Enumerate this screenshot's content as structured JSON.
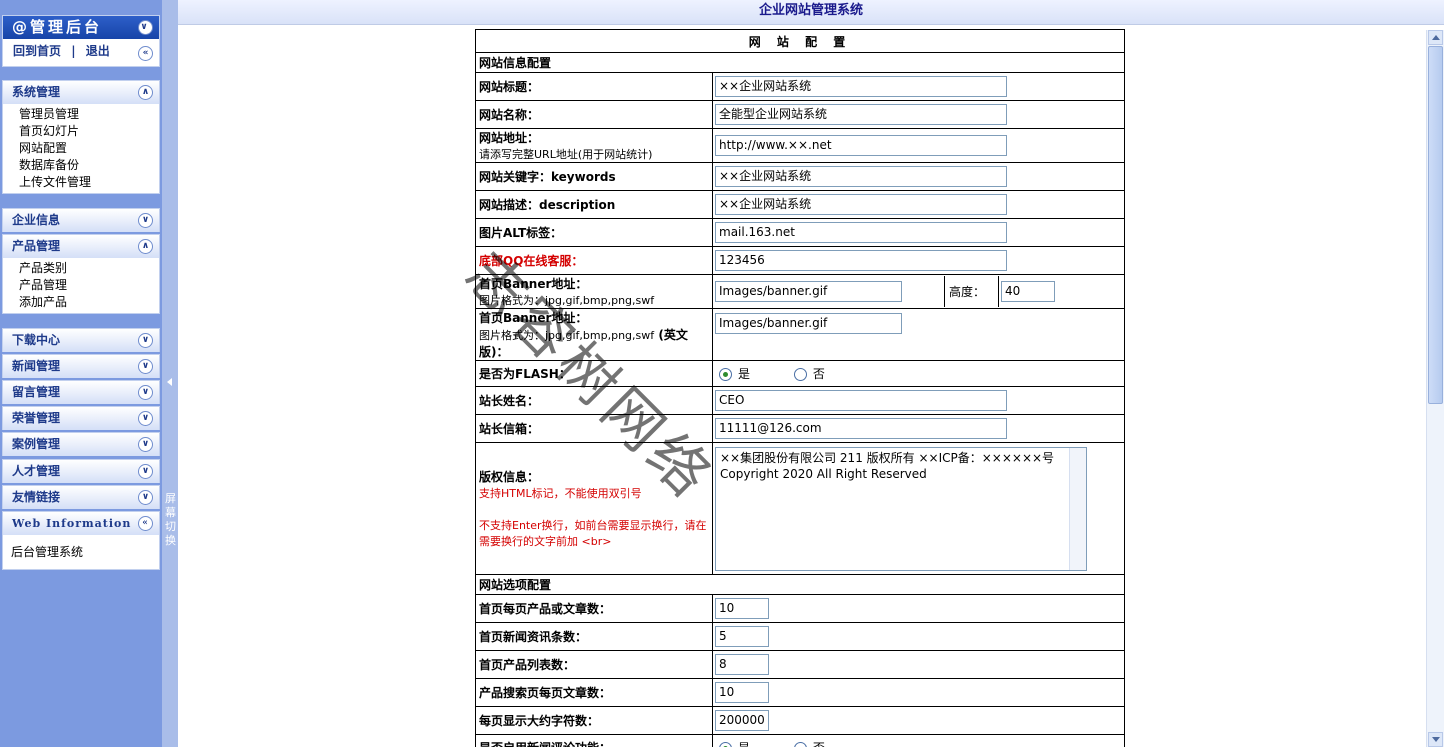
{
  "sidebar": {
    "header_title": "@管理后台",
    "home_link": "回到首页",
    "separator": "|",
    "logout_link": "退出",
    "system": {
      "title": "系统管理",
      "items": [
        "管理员管理",
        "首页幻灯片",
        "网站配置",
        "数据库备份",
        "上传文件管理"
      ]
    },
    "company": {
      "title": "企业信息"
    },
    "product": {
      "title": "产品管理",
      "items": [
        "产品类别",
        "产品管理",
        "添加产品"
      ]
    },
    "menus": [
      "下载中心",
      "新闻管理",
      "留言管理",
      "荣誉管理",
      "案例管理",
      "人才管理",
      "友情链接"
    ],
    "web_info": {
      "title": "Web Information",
      "text": "后台管理系统"
    }
  },
  "splitter": {
    "label": "屏幕切换"
  },
  "topbar": {
    "title": "企业网站管理系统"
  },
  "config": {
    "title": "网 站 配 置",
    "section_info": "网站信息配置",
    "site_title": {
      "label": "网站标题：",
      "value": "××企业网站系统"
    },
    "site_name": {
      "label": "网站名称：",
      "value": "全能型企业网站系统"
    },
    "site_url": {
      "label": "网站地址：",
      "hint": "请添写完整URL地址(用于网站统计)",
      "value": "http://www.××.net"
    },
    "keywords": {
      "label": "网站关键字：keywords",
      "value": "××企业网站系统"
    },
    "description": {
      "label": "网站描述：description",
      "value": "××企业网站系统"
    },
    "alt": {
      "label": "图片ALT标签：",
      "value": "mail.163.net"
    },
    "qq": {
      "label": "底部QQ在线客服：",
      "value": "123456"
    },
    "banner": {
      "label": "首页Banner地址：",
      "hint": "图片格式为：jpg,gif,bmp,png,swf",
      "value": "Images/banner.gif",
      "height_label": "高度：",
      "height_value": "40"
    },
    "banner_en": {
      "label": "首页Banner地址：",
      "hint": "图片格式为：jpg,gif,bmp,png,swf",
      "suffix": "(英文版)：",
      "value": "Images/banner.gif"
    },
    "flash": {
      "label": "是否为FLASH：",
      "yes": "是",
      "no": "否"
    },
    "owner": {
      "label": "站长姓名：",
      "value": "CEO"
    },
    "email": {
      "label": "站长信箱：",
      "value": "11111@126.com"
    },
    "copyright": {
      "label": "版权信息：",
      "note1": "支持HTML标记，不能使用双引号",
      "note2": "不支持Enter换行，如前台需要显示换行，请在需要换行的文字前加 <br>",
      "value": "××集团股份有限公司 211 版权所有  ××ICP备：××××××号  Copyright 2020  All Right Reserved"
    },
    "section_options": "网站选项配置",
    "per_page": {
      "label": "首页每页产品或文章数：",
      "value": "10"
    },
    "news_count": {
      "label": "首页新闻资讯条数：",
      "value": "5"
    },
    "product_list": {
      "label": "首页产品列表数：",
      "value": "8"
    },
    "search_per_page": {
      "label": "产品搜索页每页文章数：",
      "value": "10"
    },
    "max_chars": {
      "label": "每页显示大约字符数：",
      "value": "200000"
    },
    "comments": {
      "label": "是否启用新闻评论功能：",
      "yes": "是",
      "no": "否"
    }
  },
  "watermark": "志容树网络"
}
